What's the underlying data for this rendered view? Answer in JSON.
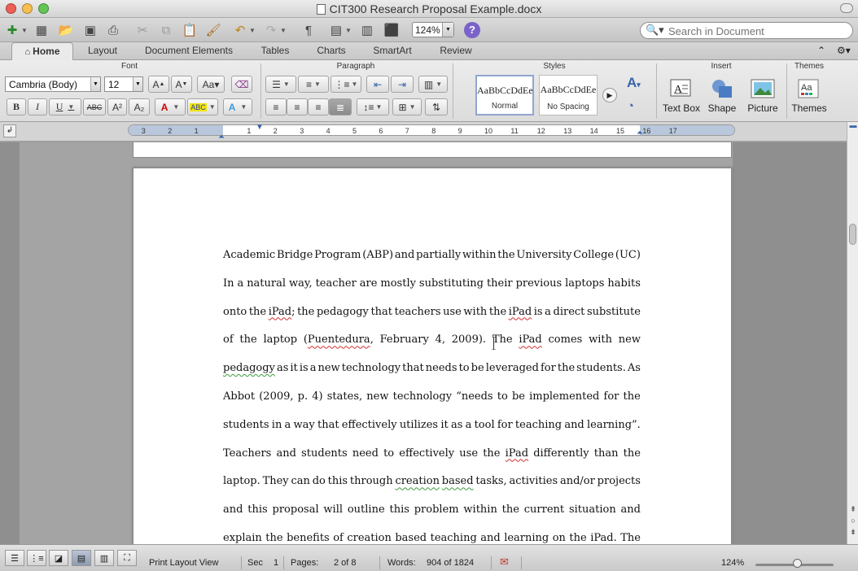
{
  "window": {
    "title": "CIT300 Research Proposal Example.docx",
    "controls": {
      "close": "#ee5f57",
      "minimize": "#f5be4f",
      "zoom": "#62c555"
    }
  },
  "toolbar": {
    "zoom_value": "124%",
    "help_glyph": "?",
    "search_placeholder": "Search in Document",
    "icons": [
      "new-document-icon",
      "template-gallery-icon",
      "open-icon",
      "save-icon",
      "print-icon",
      "cut-icon",
      "copy-icon",
      "paste-icon",
      "format-painter-icon",
      "undo-icon",
      "redo-icon",
      "pilcrow-icon",
      "sidebar-icon",
      "gallery-icon",
      "toolbox-icon",
      "zoom-icon",
      "help-icon",
      "search-icon"
    ]
  },
  "ribbon_tabs": [
    "Home",
    "Layout",
    "Document Elements",
    "Tables",
    "Charts",
    "SmartArt",
    "Review"
  ],
  "ribbon": {
    "groups": {
      "font": "Font",
      "paragraph": "Paragraph",
      "styles": "Styles",
      "insert": "Insert",
      "themes": "Themes"
    },
    "font_name": "Cambria (Body)",
    "font_size": "12",
    "format_buttons": {
      "bold": "B",
      "italic": "I",
      "underline": "U",
      "strike": "ABC",
      "superscript": "A²",
      "subscript": "A₂"
    },
    "styles": [
      {
        "sample": "AaBbCcDdEe",
        "name": "Normal"
      },
      {
        "sample": "AaBbCcDdEe",
        "name": "No Spacing"
      }
    ],
    "insert_items": [
      "Text Box",
      "Shape",
      "Picture"
    ],
    "themes_item": "Themes"
  },
  "ruler": {
    "ticks": [
      "3",
      "2",
      "1",
      "1",
      "2",
      "3",
      "4",
      "5",
      "6",
      "7",
      "8",
      "9",
      "10",
      "11",
      "12",
      "13",
      "14",
      "15",
      "16",
      "17"
    ]
  },
  "document": {
    "lines": [
      [
        {
          "t": "Academic Bridge Program (ABP) and partially within the University College (UC)"
        }
      ],
      [
        {
          "t": "In a natural way, teacher are mostly substituting their previous laptops habits"
        }
      ],
      [
        {
          "t": "onto the "
        },
        {
          "t": "iPad",
          "s": "sq"
        },
        {
          "t": "; the pedagogy that teachers use with the "
        },
        {
          "t": "iPad",
          "s": "sq"
        },
        {
          "t": " is a direct substitute"
        }
      ],
      [
        {
          "t": "of the laptop ("
        },
        {
          "t": "Puentedura",
          "s": "sq"
        },
        {
          "t": ", February 4, 2009). The "
        },
        {
          "t": "iPad",
          "s": "sq"
        },
        {
          "t": " comes with new"
        }
      ],
      [
        {
          "t": "pedagogy",
          "s": "gq"
        },
        {
          "t": " as it is a new technology that needs to be leveraged for the students. As"
        }
      ],
      [
        {
          "t": "Abbot (2009, p. 4) states, new technology “needs to be implemented for the"
        }
      ],
      [
        {
          "t": "students in a way that effectively utilizes it as a tool for teaching and learning”."
        }
      ],
      [
        {
          "t": "Teachers and students need to effectively use the "
        },
        {
          "t": "iPad",
          "s": "sq"
        },
        {
          "t": " differently than the"
        }
      ],
      [
        {
          "t": "laptop. They can do this through "
        },
        {
          "t": "creation based",
          "s": "gq"
        },
        {
          "t": " tasks, activities and/or projects"
        }
      ],
      [
        {
          "t": "and this proposal will outline this problem within the current situation and"
        }
      ],
      [
        {
          "t": "explain the benefits of creation based teaching and learning on the "
        },
        {
          "t": "iPad",
          "s": "sq"
        },
        {
          "t": ". The"
        }
      ]
    ]
  },
  "statusbar": {
    "view": "Print Layout View",
    "sec_label": "Sec",
    "sec_value": "1",
    "pages_label": "Pages:",
    "pages_value": "2 of 8",
    "words_label": "Words:",
    "words_value": "904 of 1824",
    "zoom": "124%"
  }
}
